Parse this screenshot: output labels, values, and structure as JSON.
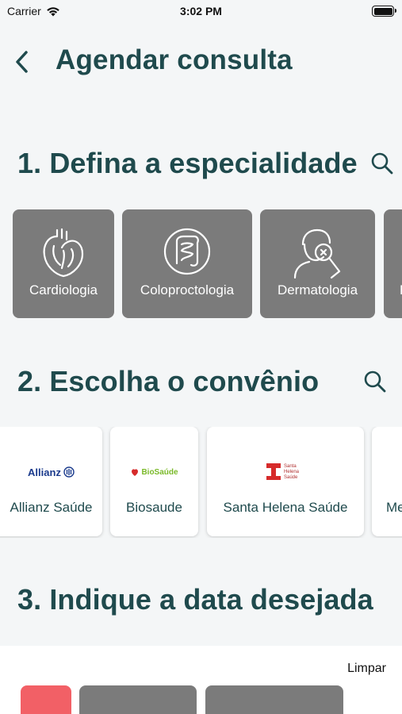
{
  "status": {
    "carrier": "Carrier",
    "time": "3:02 PM"
  },
  "header": {
    "title": "Agendar consulta"
  },
  "specialty": {
    "title": "1. Defina a especialidade",
    "items": [
      {
        "label": "Cardiologia",
        "icon": "heart-icon"
      },
      {
        "label": "Coloproctologia",
        "icon": "intestine-icon"
      },
      {
        "label": "Dermatologia",
        "icon": "dermatology-icon"
      },
      {
        "label": "E",
        "icon": "specialty-icon"
      }
    ]
  },
  "insurance": {
    "title": "2. Escolha o convênio",
    "items": [
      {
        "label": "Allianz Saúde",
        "logo_text": "Allianz"
      },
      {
        "label": "Biosaude",
        "logo_text": "BioSaúde"
      },
      {
        "label": "Santa Helena Saúde",
        "logo_text": "Santa Helena Saúde"
      },
      {
        "label": "Me"
      }
    ]
  },
  "date": {
    "title": "3. Indique a data desejada",
    "clear_label": "Limpar"
  },
  "colors": {
    "background": "#f4f6f7",
    "heading": "#1f4a4d",
    "card_gray": "#7b7b7b",
    "date_chip_active": "#f26066"
  }
}
